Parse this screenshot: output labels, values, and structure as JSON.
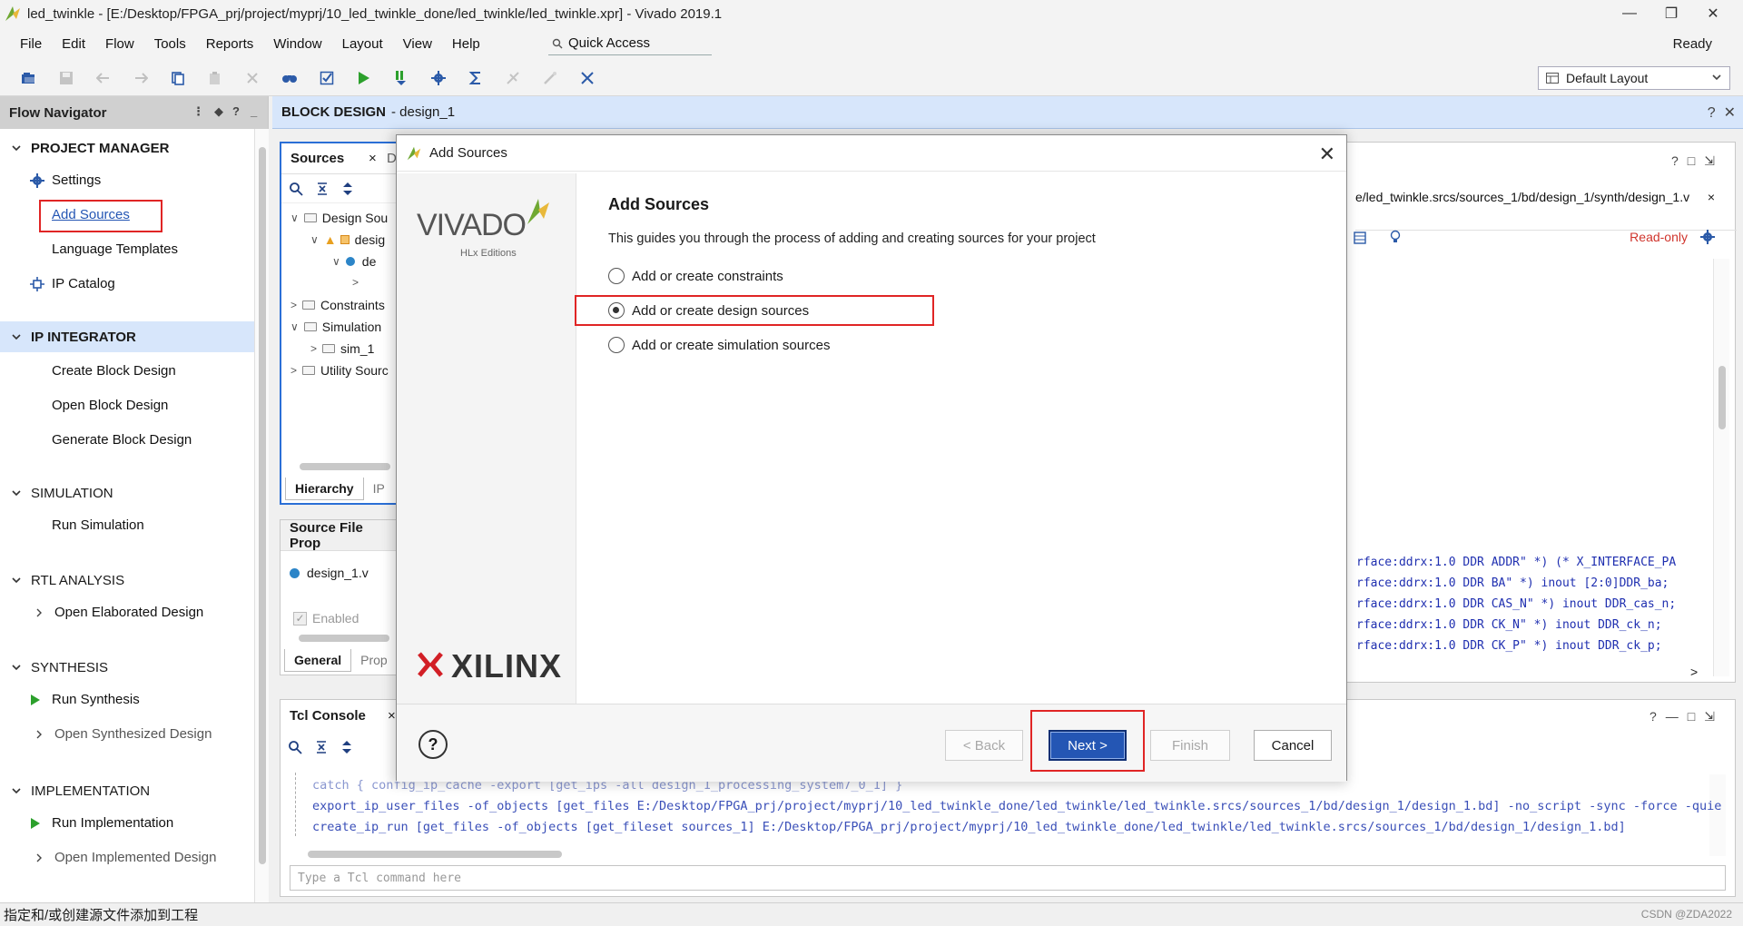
{
  "window": {
    "title": "led_twinkle - [E:/Desktop/FPGA_prj/project/myprj/10_led_twinkle_done/led_twinkle/led_twinkle.xpr] - Vivado 2019.1"
  },
  "menu": [
    "File",
    "Edit",
    "Flow",
    "Tools",
    "Reports",
    "Window",
    "Layout",
    "View",
    "Help"
  ],
  "quick_access": "Quick Access",
  "status_ready": "Ready",
  "layout_select": "Default Layout",
  "flow_navigator": {
    "title": "Flow Navigator",
    "sections": [
      {
        "label": "PROJECT MANAGER",
        "items": [
          "Settings",
          "Add Sources",
          "Language Templates",
          "IP Catalog"
        ]
      },
      {
        "label": "IP INTEGRATOR",
        "items": [
          "Create Block Design",
          "Open Block Design",
          "Generate Block Design"
        ]
      },
      {
        "label": "SIMULATION",
        "items": [
          "Run Simulation"
        ]
      },
      {
        "label": "RTL ANALYSIS",
        "items": [
          "Open Elaborated Design"
        ]
      },
      {
        "label": "SYNTHESIS",
        "items": [
          "Run Synthesis",
          "Open Synthesized Design"
        ]
      },
      {
        "label": "IMPLEMENTATION",
        "items": [
          "Run Implementation",
          "Open Implemented Design"
        ]
      }
    ]
  },
  "block_design": {
    "title": "BLOCK DESIGN",
    "name": "- design_1"
  },
  "sources_panel": {
    "title": "Sources",
    "tab_peek": "D",
    "tree": [
      "Design Sou",
      "desig",
      "de",
      "Constraints",
      "Simulation",
      "sim_1",
      "Utility Sourc"
    ],
    "tabs": [
      "Hierarchy",
      "IP"
    ]
  },
  "source_props": {
    "title": "Source File Prop",
    "file": "design_1.v",
    "enabled": "Enabled",
    "tabs": [
      "General",
      "Prop"
    ]
  },
  "editor": {
    "path": "e/led_twinkle.srcs/sources_1/bd/design_1/synth/design_1.v",
    "readonly": "Read-only",
    "code": [
      "rface:ddrx:1.0 DDR ADDR\" *) (* X_INTERFACE_PA",
      "rface:ddrx:1.0 DDR BA\" *) inout [2:0]DDR_ba;",
      "rface:ddrx:1.0 DDR CAS_N\" *) inout DDR_cas_n;",
      "rface:ddrx:1.0 DDR CK_N\" *) inout DDR_ck_n;",
      "rface:ddrx:1.0 DDR CK_P\" *) inout DDR_ck_p;"
    ]
  },
  "tcl": {
    "title": "Tcl Console",
    "lines": [
      "catch { config_ip_cache -export [get_ips -all design_1_processing_system7_0_1] }",
      "export_ip_user_files -of_objects [get_files E:/Desktop/FPGA_prj/project/myprj/10_led_twinkle_done/led_twinkle/led_twinkle.srcs/sources_1/bd/design_1/design_1.bd] -no_script -sync -force -quie",
      "create_ip_run [get_files -of_objects [get_fileset sources_1] E:/Desktop/FPGA_prj/project/myprj/10_led_twinkle_done/led_twinkle/led_twinkle.srcs/sources_1/bd/design_1/design_1.bd]"
    ],
    "placeholder": "Type a Tcl command here"
  },
  "dialog": {
    "title": "Add Sources",
    "heading": "Add Sources",
    "description": "This guides you through the process of adding and creating sources for your project",
    "options": [
      "Add or create constraints",
      "Add or create design sources",
      "Add or create simulation sources"
    ],
    "selected": 1,
    "brand_top": "VIVADO",
    "brand_sub": "HLx Editions",
    "brand_bottom": "XILINX",
    "help": "?",
    "buttons": {
      "back": "< Back",
      "next": "Next >",
      "finish": "Finish",
      "cancel": "Cancel"
    }
  },
  "statusbar": {
    "message": "指定和/或创建源文件添加到工程",
    "watermark": "CSDN @ZDA2022"
  },
  "colors": {
    "accent": "#2456b4",
    "highlight": "#d7e6fb",
    "annotation": "#e02525",
    "run_green": "#2ca02c"
  }
}
